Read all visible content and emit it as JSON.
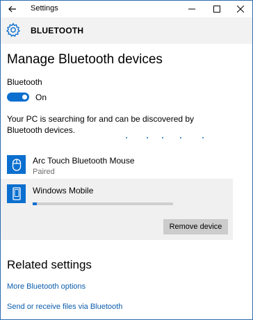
{
  "window": {
    "title": "Settings"
  },
  "header": {
    "title": "BLUETOOTH"
  },
  "main": {
    "heading": "Manage Bluetooth devices",
    "bluetooth_label": "Bluetooth",
    "toggle": {
      "state": "On",
      "on": true
    },
    "status_text": "Your PC is searching for and can be discovered by Bluetooth devices.",
    "devices": [
      {
        "name": "Arc Touch Bluetooth Mouse",
        "status": "Paired",
        "icon": "mouse-icon"
      },
      {
        "name": "Windows Mobile",
        "icon": "phone-icon",
        "progress": 0.03,
        "action": "Remove device"
      }
    ]
  },
  "related": {
    "heading": "Related settings",
    "links": [
      "More Bluetooth options",
      "Send or receive files via Bluetooth"
    ]
  },
  "colors": {
    "accent": "#0b6fcf",
    "link": "#0b5cad",
    "header_bg": "#f2f2f2",
    "selected_bg": "#f0f0f0"
  }
}
